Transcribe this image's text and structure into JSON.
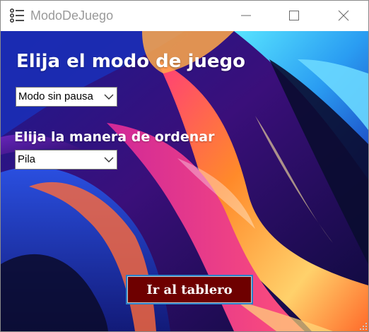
{
  "window": {
    "title": "ModoDeJuego",
    "icon": "list-icon",
    "controls": [
      "minimize",
      "maximize",
      "close"
    ]
  },
  "form": {
    "heading": "Elija el modo de juego",
    "mode_select": {
      "selected": "Modo sin pausa"
    },
    "order_label": "Elija la manera de ordenar",
    "order_select": {
      "selected": "Pila"
    },
    "go_button": "Ir al tablero"
  },
  "colors": {
    "button_bg": "#6e0000",
    "button_border": "#2a80c8",
    "text": "#ffffff",
    "title_text": "#9a9a9a"
  }
}
